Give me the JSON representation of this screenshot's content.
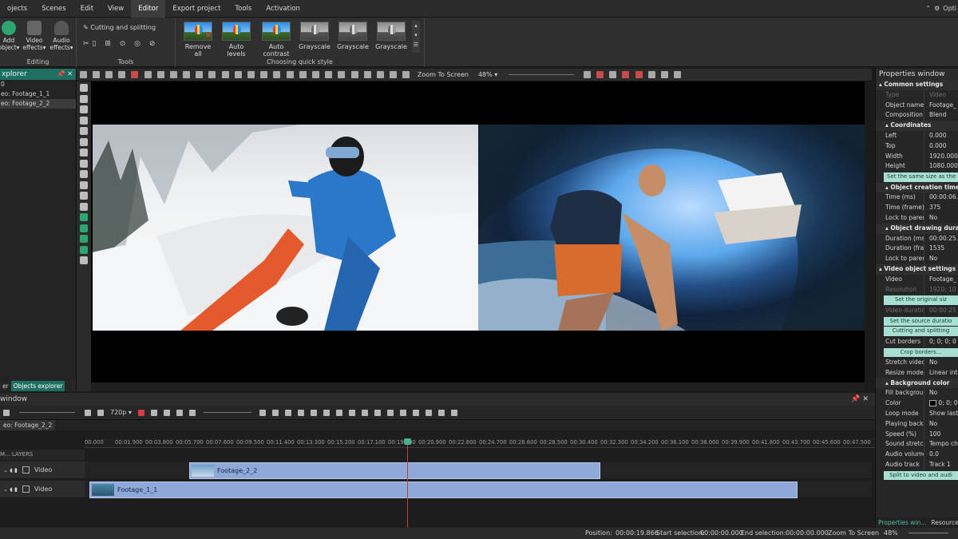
{
  "menu": {
    "items": [
      "ojects",
      "Scenes",
      "Edit",
      "View",
      "Editor",
      "Export project",
      "Tools",
      "Activation"
    ],
    "active": "Editor",
    "options_label": "Opti"
  },
  "ribbon": {
    "editing": {
      "label": "Editing",
      "buttons": [
        "Add object",
        "Video effects",
        "Audio effects"
      ]
    },
    "tools": {
      "label": "Tools",
      "cutting": "Cutting and splitting"
    },
    "quick_style": {
      "label": "Choosing quick style",
      "thumbs": [
        "Remove all",
        "Auto levels",
        "Auto contrast",
        "Grayscale",
        "Grayscale",
        "Grayscale"
      ]
    }
  },
  "explorer": {
    "title": "xplorer",
    "rows": [
      "0",
      "eo: Footage_1_1",
      "eo: Footage_2_2"
    ],
    "tabs": [
      "er",
      "Objects explorer"
    ]
  },
  "preview_toolbar": {
    "zoom_mode": "Zoom To Screen",
    "zoom": "48%"
  },
  "properties": {
    "title": "Properties window",
    "common": "Common settings",
    "type": {
      "key": "Type",
      "value": "Video"
    },
    "object_name": {
      "key": "Object name",
      "value": "Footage_"
    },
    "composition": {
      "key": "Composition m",
      "value": "Blend"
    },
    "coordinates": "Coordinates",
    "left": {
      "key": "Left",
      "value": "0.000"
    },
    "top": {
      "key": "Top",
      "value": "0.000"
    },
    "width": {
      "key": "Width",
      "value": "1920.000"
    },
    "height": {
      "key": "Height",
      "value": "1080.000"
    },
    "same_size_btn": "Set the same size as the pare",
    "creation_time": "Object creation time",
    "time_ms": {
      "key": "Time (ms)",
      "value": "00:00:06.2"
    },
    "time_frame": {
      "key": "Time (frame)",
      "value": "375"
    },
    "lock1": {
      "key": "Lock to paren",
      "value": "No"
    },
    "drawing_duration": "Object drawing durati",
    "duration_ms": {
      "key": "Duration (ms",
      "value": "00:00:25.5"
    },
    "duration_fr": {
      "key": "Duration (fra",
      "value": "1535"
    },
    "lock2": {
      "key": "Lock to paren",
      "value": "No"
    },
    "video_settings": "Video object settings",
    "video": {
      "key": "Video",
      "value": "Footage_"
    },
    "resolution": {
      "key": "Resolution",
      "value": "1920; 10"
    },
    "original_btn": "Set the original siz",
    "video_duration": {
      "key": "Video duration",
      "value": "00:00:25"
    },
    "source_btn": "Set the source duratio",
    "cutting_btn": "Cutting and splitting",
    "cut_borders": {
      "key": "Cut borders",
      "value": "0; 0; 0; 0"
    },
    "crop_btn": "Crop borders...",
    "stretch": {
      "key": "Stretch video",
      "value": "No"
    },
    "resize": {
      "key": "Resize mode",
      "value": "Linear int"
    },
    "bg_color": "Background color",
    "fill": {
      "key": "Fill backgrou",
      "value": "No"
    },
    "color": {
      "key": "Color",
      "value": "0; 0; 0"
    },
    "loop": {
      "key": "Loop mode",
      "value": "Show last"
    },
    "playing": {
      "key": "Playing backwa",
      "value": "No"
    },
    "speed": {
      "key": "Speed (%)",
      "value": "100"
    },
    "sound_stretch": {
      "key": "Sound stretchin",
      "value": "Tempo ch"
    },
    "audio_volume": {
      "key": "Audio volume (",
      "value": "0.0"
    },
    "audio_track": {
      "key": "Audio track",
      "value": "Track 1"
    },
    "split_btn": "Split to video and audi",
    "tabs": [
      "Properties win...",
      "Resource"
    ]
  },
  "timeline": {
    "title": "window",
    "quality": "720p",
    "tab": "eo: Footage_2_2",
    "layers_label": "M... LAYERS",
    "ruler": [
      "00.000",
      "00:01.900",
      "00:03.800",
      "00:05.700",
      "00:07.600",
      "00:09.500",
      "00:11.400",
      "00:13.300",
      "00:15.200",
      "00:17.100",
      "00:19.000",
      "00:20.900",
      "00:22.800",
      "00:24.700",
      "00:26.600",
      "00:28.500",
      "00:30.400",
      "00:32.300",
      "00:34.200",
      "00:36.100",
      "00:38.000",
      "00:39.900",
      "00:41.800",
      "00:43.700",
      "00:45.600",
      "00:47.500"
    ],
    "tracks": [
      {
        "label": "Video",
        "clip": "Footage_2_2"
      },
      {
        "label": "Video",
        "clip": "Footage_1_1"
      }
    ]
  },
  "status": {
    "position_label": "Position:",
    "position": "00:00:19.866",
    "start_label": "Start selection:",
    "start": "00:00:00.000",
    "end_label": "End selection:",
    "end": "00:00:00.000",
    "zoom_label": "Zoom To Screen",
    "zoom": "48%"
  },
  "colors": {
    "accent": "#1e6e62",
    "button": "#a7e0d2",
    "clip": "#8ea8d8",
    "playhead": "#c73a3a"
  }
}
